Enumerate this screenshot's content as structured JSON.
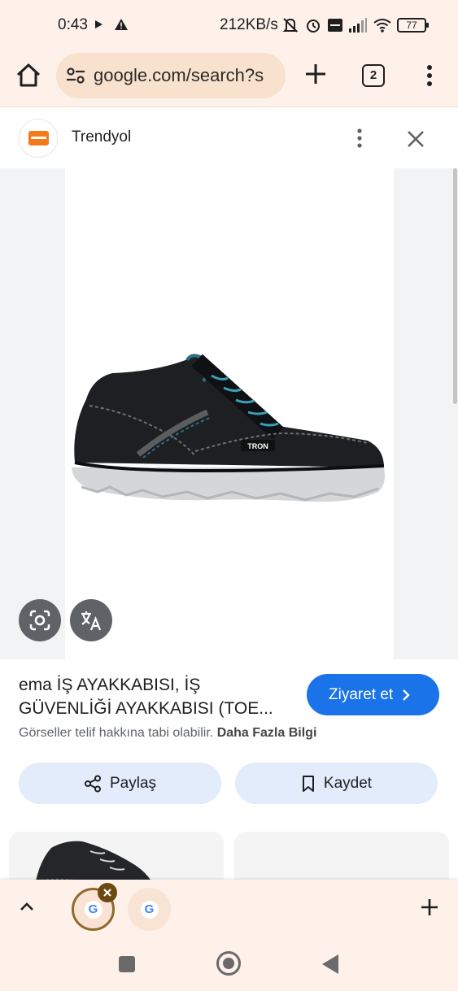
{
  "status_bar": {
    "time": "0:43",
    "network_speed": "212KB/s",
    "battery": "77"
  },
  "browser": {
    "url": "google.com/search?s",
    "tab_count": "2"
  },
  "source": {
    "name": "Trendyol",
    "logo_text": "trendyol",
    "brand_color": "#f27a1a"
  },
  "result": {
    "title_line1": "ema İŞ AYAKKABISI, İŞ",
    "title_line2": "GÜVENLİĞİ AYAKKABISI (TOE...",
    "visit_label": "Ziyaret et",
    "copyright_text": "Görseller telif hakkına tabi olabilir.",
    "more_info_label": "Daha Fazla Bilgi",
    "share_label": "Paylaş",
    "save_label": "Kaydet",
    "accent_color": "#1a73e8"
  },
  "product_image": {
    "brand_label": "TRON"
  }
}
